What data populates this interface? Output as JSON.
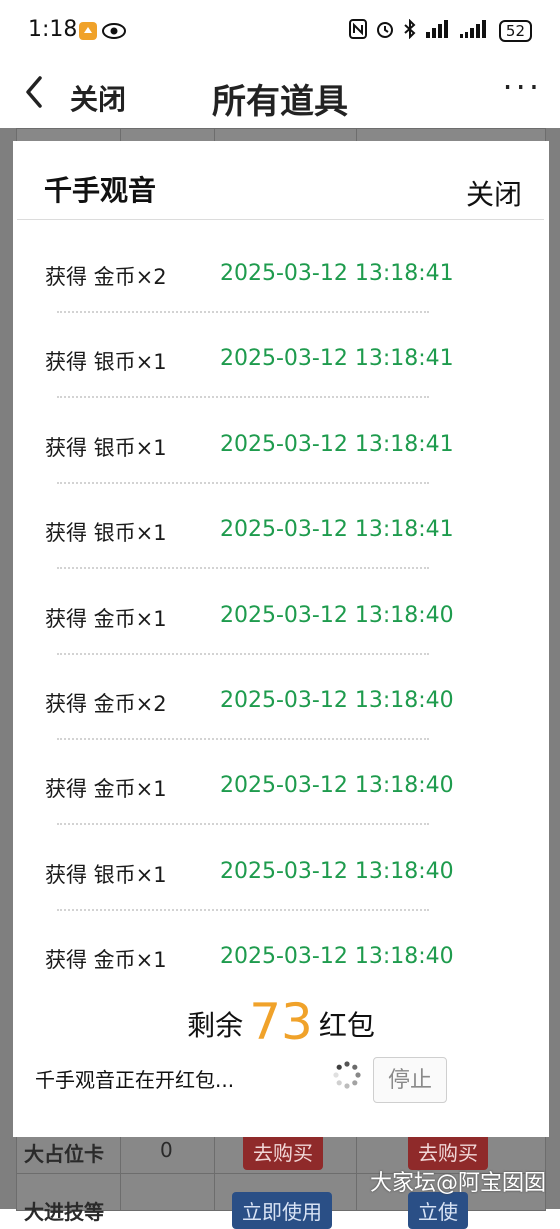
{
  "status_bar": {
    "time": "1:18",
    "battery": "52"
  },
  "nav": {
    "close_label": "关闭",
    "title": "所有道具",
    "more": "···"
  },
  "background_table": {
    "row1": {
      "label": "大占位卡",
      "count": "0",
      "buy": "去购买",
      "buy2": "去购买"
    },
    "row2": {
      "label": "大进技等",
      "use": "立即使用",
      "use2": "立使"
    }
  },
  "watermark": "大家坛@阿宝囡囡",
  "modal": {
    "title": "千手观音",
    "close_label": "关闭",
    "items": [
      {
        "text": "获得 金币×2",
        "time": "2025-03-12 13:18:41"
      },
      {
        "text": "获得 银币×1",
        "time": "2025-03-12 13:18:41"
      },
      {
        "text": "获得 银币×1",
        "time": "2025-03-12 13:18:41"
      },
      {
        "text": "获得 银币×1",
        "time": "2025-03-12 13:18:41"
      },
      {
        "text": "获得 金币×1",
        "time": "2025-03-12 13:18:40"
      },
      {
        "text": "获得 金币×2",
        "time": "2025-03-12 13:18:40"
      },
      {
        "text": "获得 金币×1",
        "time": "2025-03-12 13:18:40"
      },
      {
        "text": "获得 银币×1",
        "time": "2025-03-12 13:18:40"
      },
      {
        "text": "获得 金币×1",
        "time": "2025-03-12 13:18:40"
      }
    ],
    "remaining_prefix": "剩余",
    "remaining_count": "73",
    "remaining_suffix": "红包",
    "status_text": "千手观音正在开红包...",
    "stop_label": "停止"
  },
  "colors": {
    "time_green": "#1e9b4d",
    "count_orange": "#f0a22a"
  }
}
